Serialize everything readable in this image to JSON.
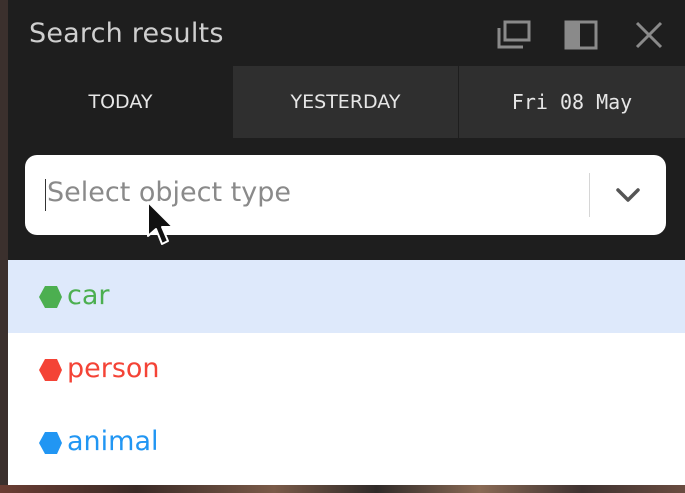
{
  "window": {
    "title": "Search results"
  },
  "tabs": [
    {
      "label": "TODAY"
    },
    {
      "label": "YESTERDAY"
    },
    {
      "label": "Fri 08 May"
    }
  ],
  "select": {
    "placeholder": "Select object type"
  },
  "options": [
    {
      "label": "car",
      "color": "#4caf50"
    },
    {
      "label": "person",
      "color": "#f44336"
    },
    {
      "label": "animal",
      "color": "#2196f3"
    }
  ],
  "colors": {
    "panel": "#1e1e1e",
    "highlight": "#dee9fb"
  }
}
